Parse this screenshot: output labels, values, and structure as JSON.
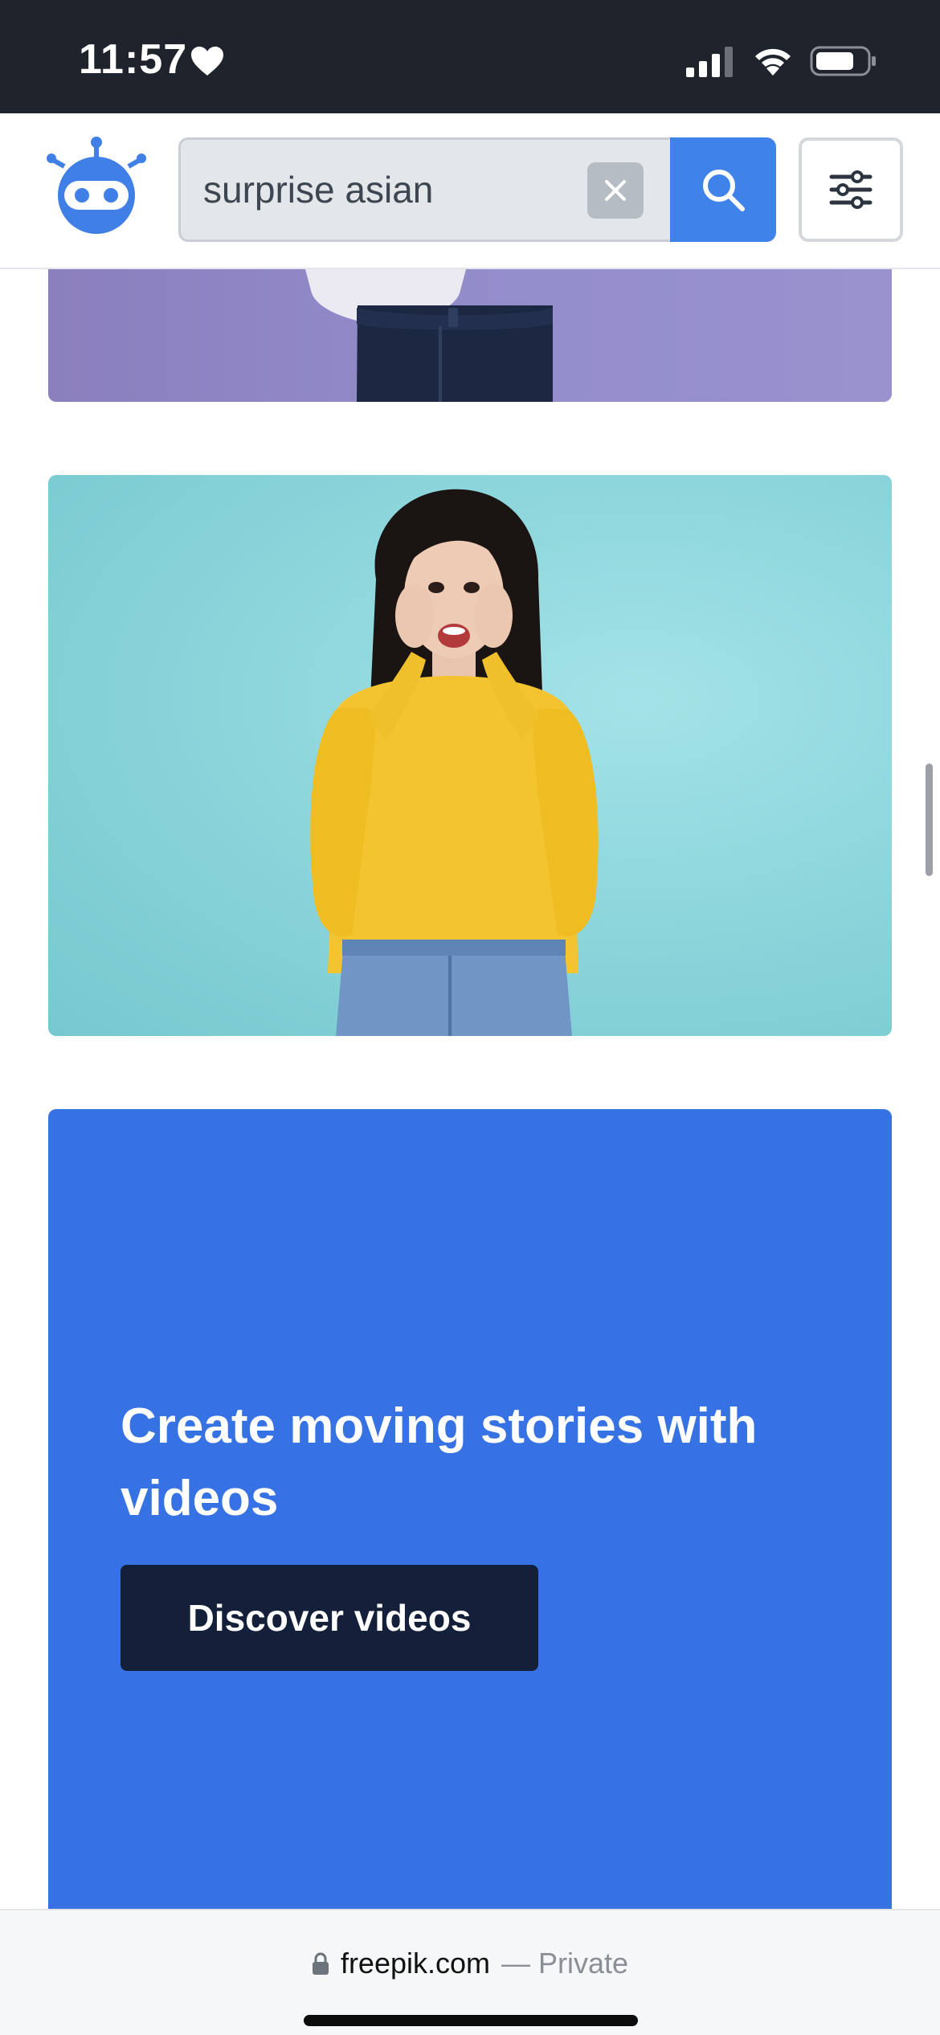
{
  "status_bar": {
    "time": "11:57",
    "heart_icon": "heart-icon",
    "signal_icon": "cellular-signal-icon",
    "wifi_icon": "wifi-icon",
    "battery_icon": "battery-icon"
  },
  "header": {
    "logo_icon": "robot-logo-icon",
    "search": {
      "value": "surprise asian",
      "clear_icon": "close-icon",
      "search_icon": "search-icon"
    },
    "filter_icon": "sliders-icon"
  },
  "promo": {
    "title": "Create moving stories with videos",
    "button_label": "Discover videos"
  },
  "browser_bar": {
    "lock_icon": "lock-icon",
    "domain": "freepik.com",
    "suffix": "— Private"
  },
  "colors": {
    "status_bar_bg": "#1f232b",
    "accent_blue": "#3f83ea",
    "promo_bg": "#3672e3",
    "promo_button_bg": "#14203a",
    "card_purple": "#948dcc",
    "card_teal": "#8dd6dc"
  }
}
